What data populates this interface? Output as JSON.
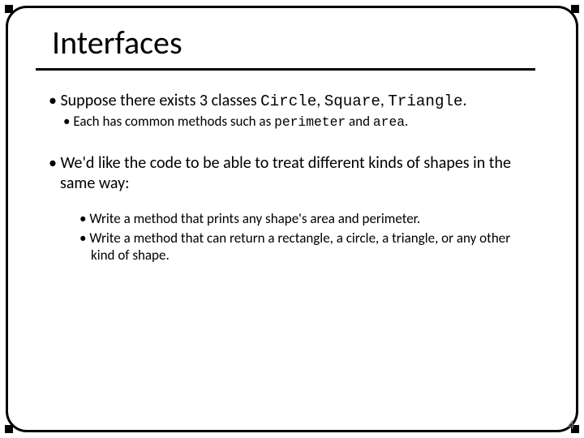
{
  "slide": {
    "title": "Interfaces",
    "bullets": {
      "b1_pre": "Suppose there exists 3 classes ",
      "b1_c1": "Circle",
      "b1_sep1": ", ",
      "b1_c2": "Square",
      "b1_sep2": ", ",
      "b1_c3": "Triangle",
      "b1_post": ".",
      "b1a_pre": "Each has common methods such as ",
      "b1a_c1": "perimeter",
      "b1a_mid": " and ",
      "b1a_c2": "area",
      "b1a_post": ".",
      "b2": "We'd like the code to be able to treat different kinds of shapes in the same way:",
      "b2a": "Write a method that prints any shape's area and perimeter.",
      "b2b": "Write a method that can return a rectangle, a circle, a triangle, or any other kind of shape."
    },
    "page_number": "4"
  }
}
